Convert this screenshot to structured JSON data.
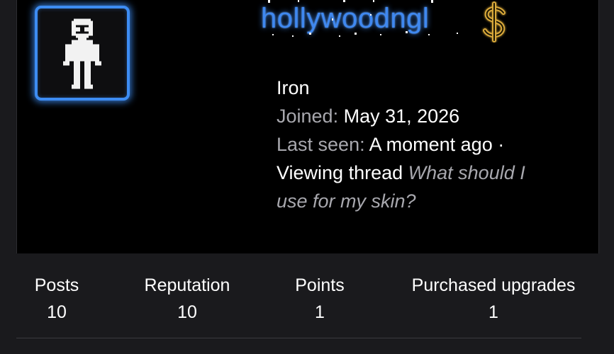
{
  "profile": {
    "username": "hollywoodngl",
    "rank": "Iron",
    "joined_label": "Joined:",
    "joined_value": "May 31, 2026",
    "last_seen_label": "Last seen:",
    "last_seen_value": "A moment ago ·",
    "activity_prefix": "Viewing thread",
    "activity_thread_line1": "What should I",
    "activity_thread_line2": "use for my skin?",
    "avatar_icon": "pixel-person-icon",
    "upgrade_icon": "dollar-sign-icon"
  },
  "stats": {
    "posts_label": "Posts",
    "posts_value": "10",
    "reputation_label": "Reputation",
    "reputation_value": "10",
    "points_label": "Points",
    "points_value": "1",
    "upgrades_label": "Purchased upgrades",
    "upgrades_value": "1"
  },
  "colors": {
    "username": "#3f88f0",
    "avatar_border": "#3d8cf2",
    "dollar": "#d9a93a",
    "card_bg": "#000000",
    "page_bg": "#1a1a1d",
    "muted_text": "#a8a8ae"
  }
}
